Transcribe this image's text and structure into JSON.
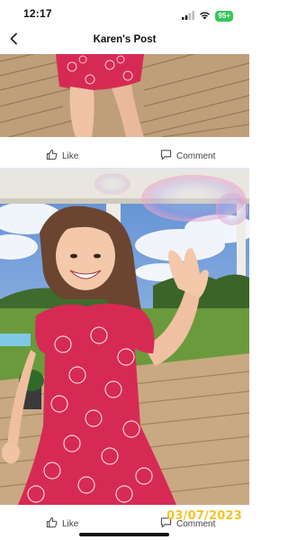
{
  "status_bar": {
    "time": "12:17",
    "battery": "95+",
    "battery_color": "#34c759"
  },
  "nav": {
    "title": "Karen's Post",
    "back_icon": "chevron-left-icon"
  },
  "posts": [
    {
      "like_label": "Like",
      "comment_label": "Comment"
    },
    {
      "like_label": "Like",
      "comment_label": "Comment",
      "date_stamp": "03/07/2023"
    }
  ],
  "icons": {
    "like": "thumbs-up-icon",
    "comment": "speech-bubble-icon",
    "signal": "cellular-signal-icon",
    "wifi": "wifi-icon"
  },
  "colors": {
    "date_stamp": "#f2c42a",
    "dress": "#d62a55",
    "deck": "#c9a982"
  }
}
